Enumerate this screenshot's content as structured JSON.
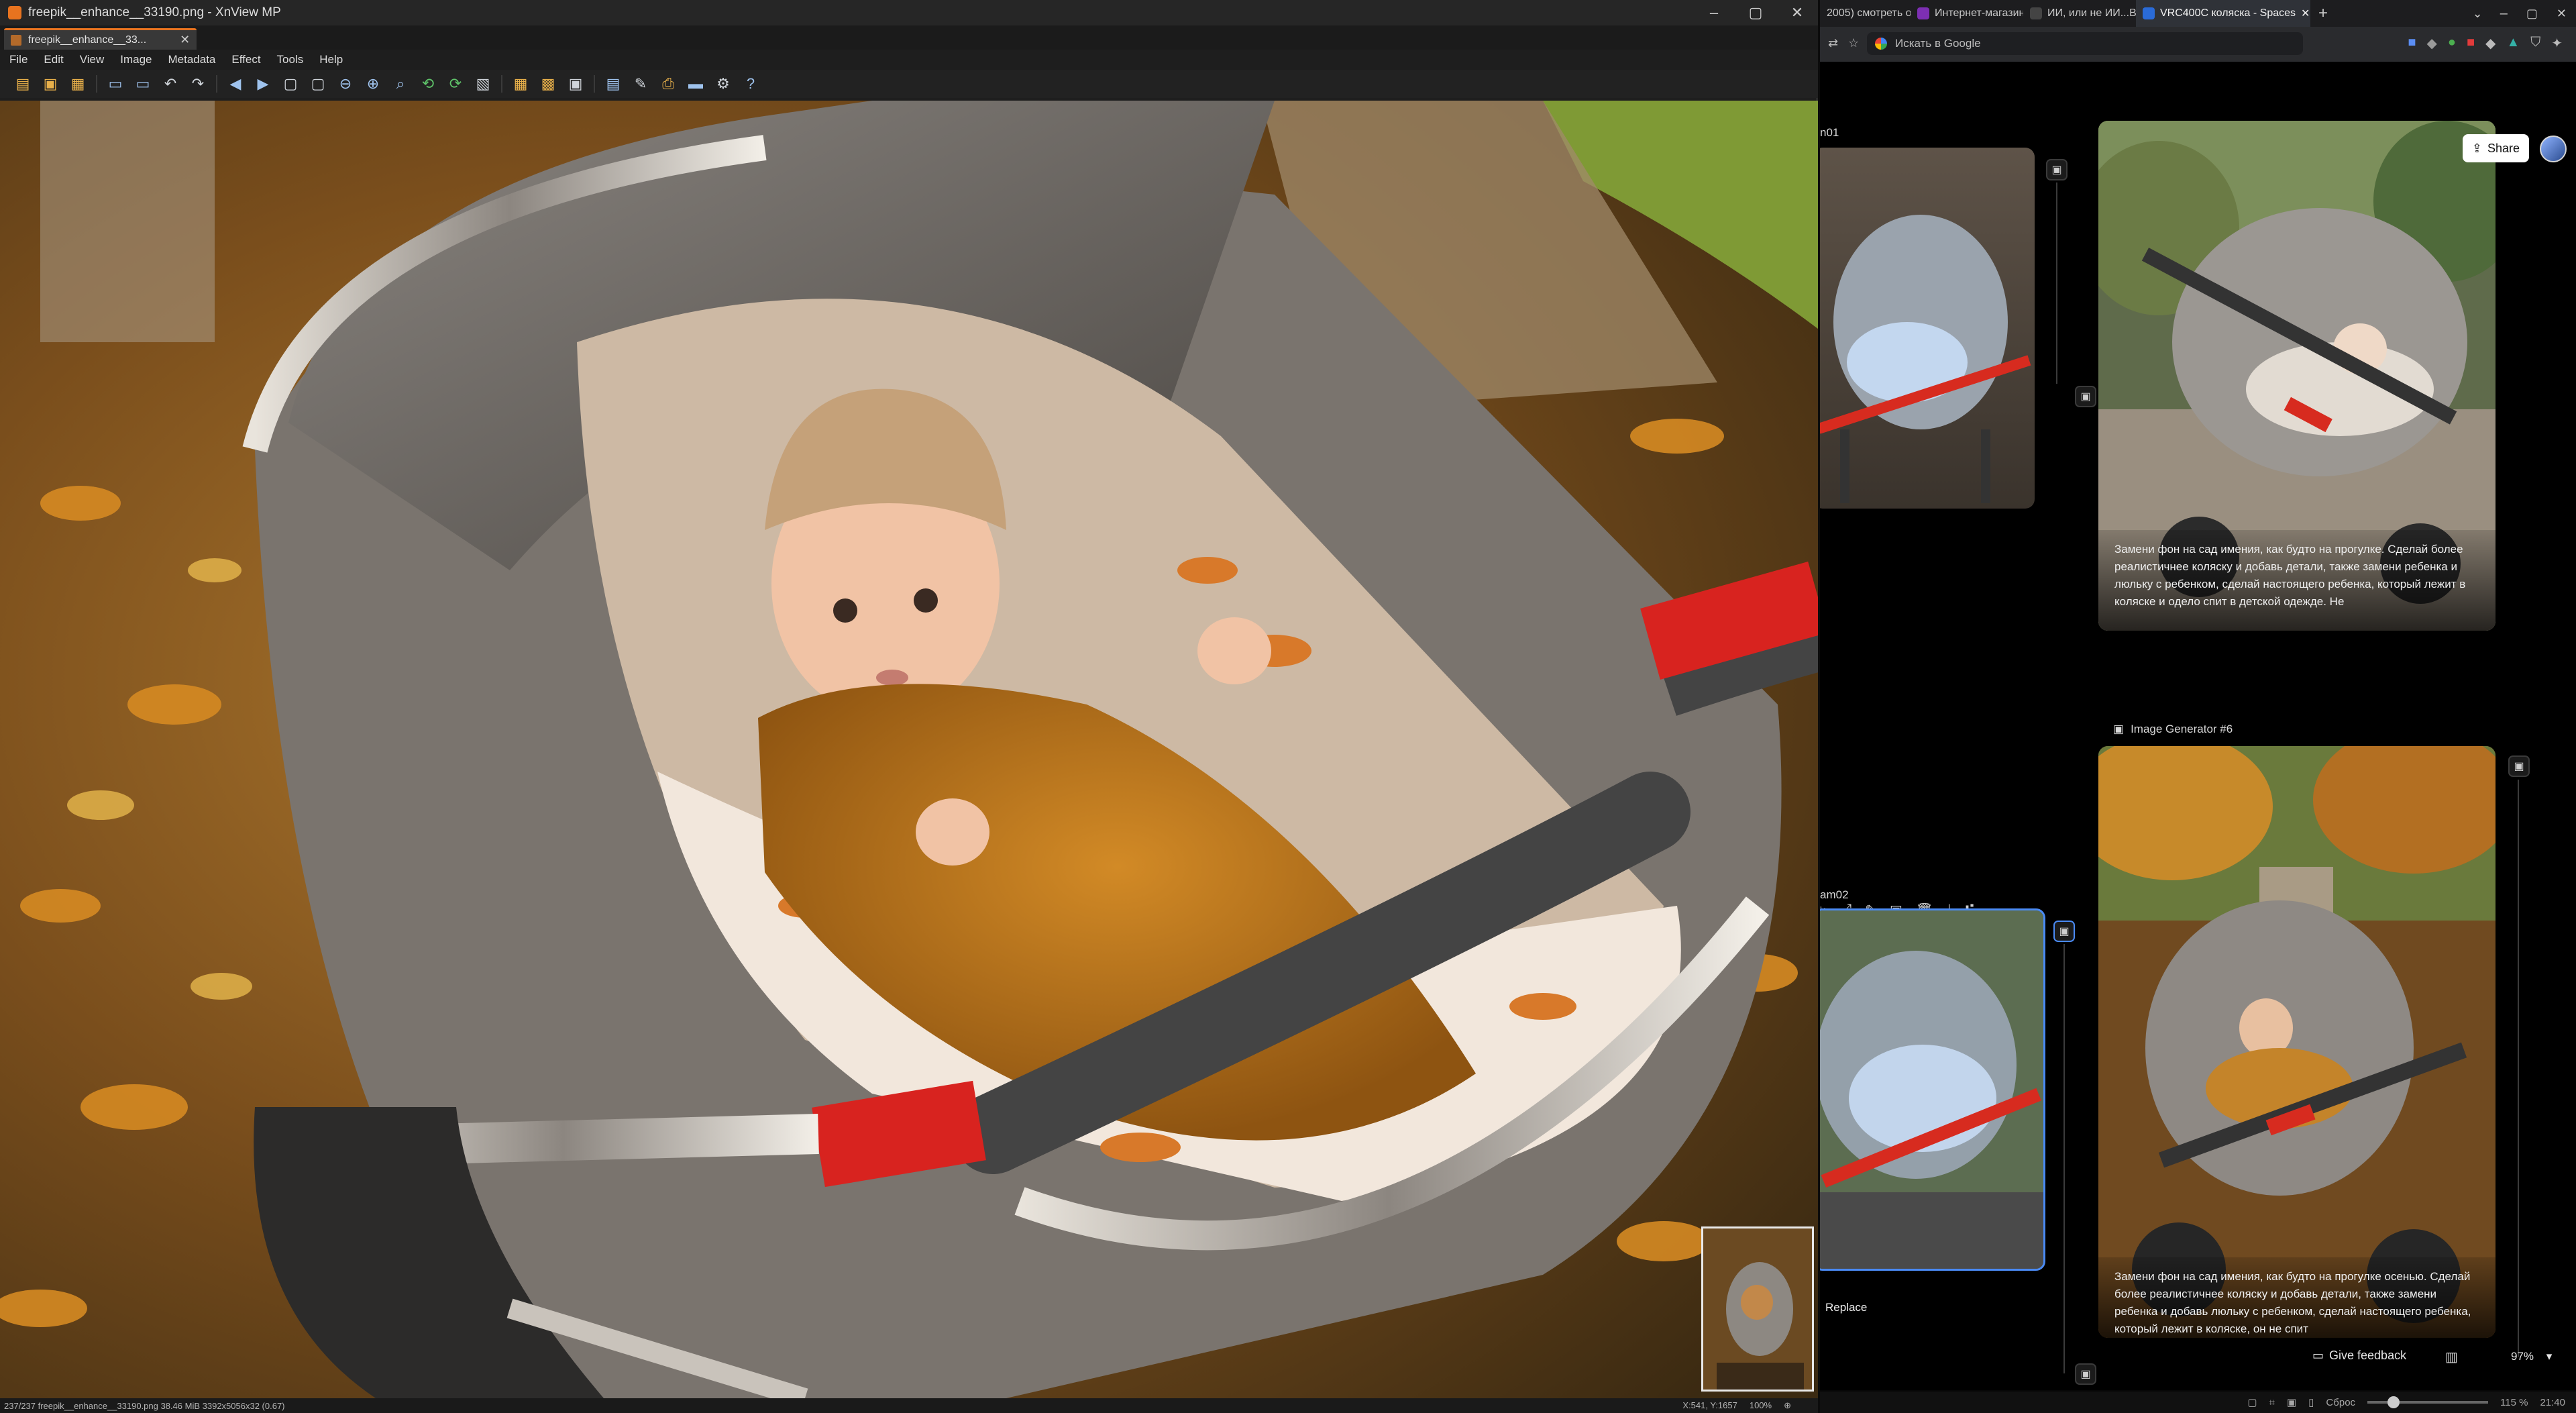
{
  "xnview": {
    "title": "freepik__enhance__33190.png - XnView MP",
    "tab_label": "freepik__enhance__33...",
    "menu": [
      "File",
      "Edit",
      "View",
      "Image",
      "Metadata",
      "Effect",
      "Tools",
      "Help"
    ],
    "status_left": "237/237   freepik__enhance__33190.png   38.46 MiB   3392x5056x32 (0.67)",
    "status_coords": "X:541, Y:1657",
    "status_zoom": "100%"
  },
  "browser": {
    "tabs": [
      {
        "label": "2005) смотреть о",
        "color": "#3a3a3a"
      },
      {
        "label": "Интернет-магазин W",
        "color": "#7d2fb3"
      },
      {
        "label": "ИИ, или не ИИ...Вио н",
        "color": "#3a3a3a"
      },
      {
        "label": "VRC400C коляска - Spaces",
        "color": "#2a6bd8"
      }
    ],
    "address_placeholder": "Искать в Google",
    "share_label": "Share",
    "node1_label": "n01",
    "node2_label": "Image Generator #6",
    "node3_label": "am02",
    "caption1": "Замени фон на сад имения, как будто на прогулке. Сделай более реалистичнее коляску и добавь детали, также замени ребенка и люльку с ребенком, сделай настоящего ребенка, который лежит в коляске и одело спит в детской одежде. Не",
    "caption2": "Замени фон на сад имения, как будто на прогулке осенью. Сделай более реалистичнее коляску и добавь детали, также замени ребенка и добавь люльку с ребенком, сделай настоящего ребенка, который лежит в коляске, он не спит",
    "replace_label": "Replace",
    "feedback_label": "Give feedback",
    "zoom_label": "97%",
    "bottom_zoom": "115 %",
    "bottom_reset": "Сброс",
    "clock": "21:40"
  }
}
